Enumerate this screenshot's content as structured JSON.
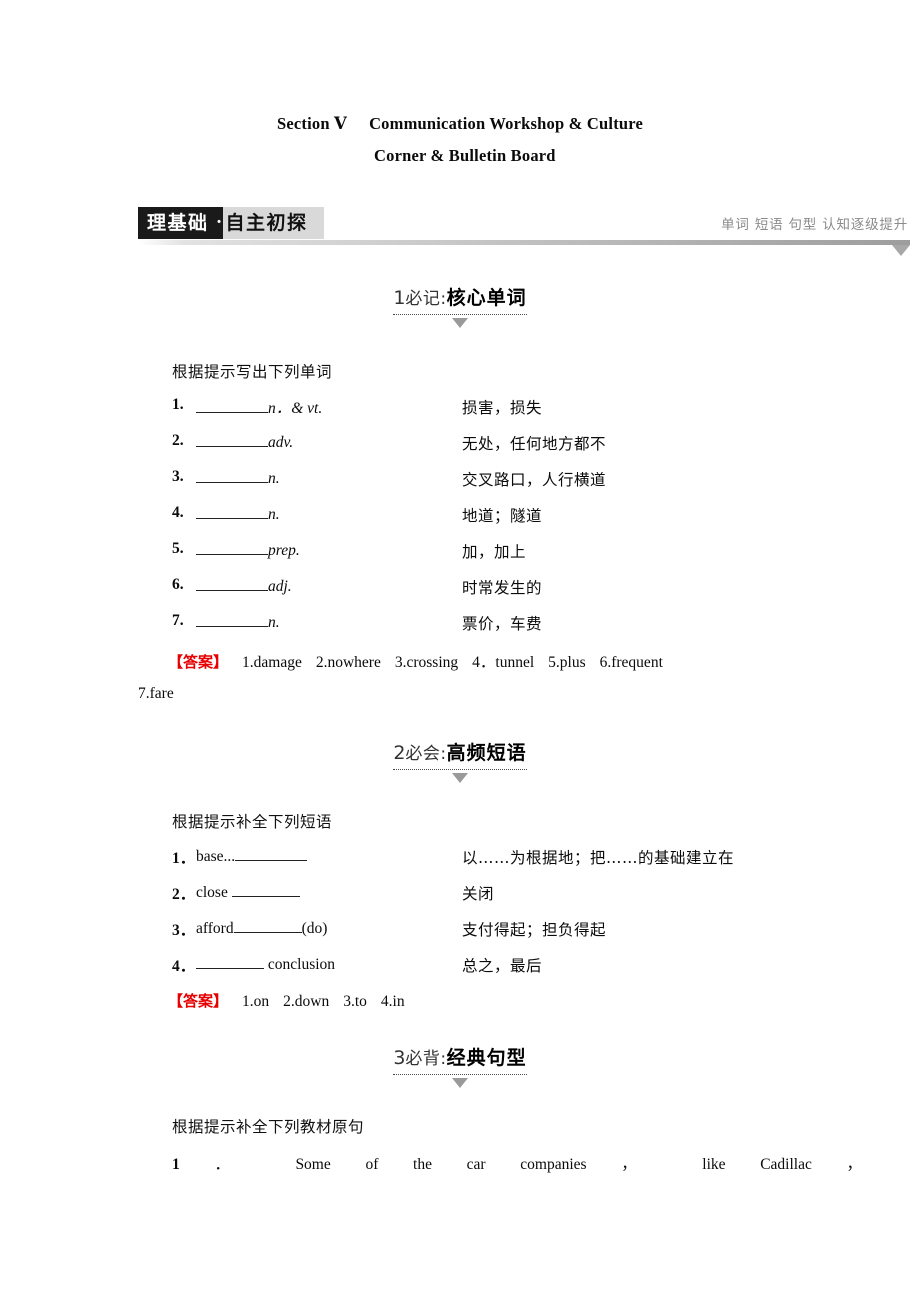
{
  "title": {
    "section_label": "Section Ⅴ",
    "line1": "Communication Workshop & Culture",
    "line2": "Corner & Bulletin Board"
  },
  "banner": {
    "tab_black": "理基础",
    "tab_dot": "·",
    "tab_gray": "自主初探",
    "subtitle": "单词 短语 句型 认知逐级提升",
    "accent_black": "#1a1a1a",
    "accent_gray": "#d9d9d9"
  },
  "sections": [
    {
      "num": "1",
      "pre": "必记:",
      "main": "核心单词",
      "lead": "根据提示写出下列单词",
      "items": [
        {
          "num": "1.",
          "blank": "",
          "pos": "n．& vt.",
          "def": "损害，损失"
        },
        {
          "num": "2.",
          "blank": "",
          "pos": "adv.",
          "def": "无处，任何地方都不"
        },
        {
          "num": "3.",
          "blank": "",
          "pos": "n.",
          "def": "交叉路口，人行横道"
        },
        {
          "num": "4.",
          "blank": "",
          "pos": "n.",
          "def": "地道；隧道"
        },
        {
          "num": "5.",
          "blank": "",
          "pos": "prep.",
          "def": "加，加上"
        },
        {
          "num": "6.",
          "blank": "",
          "pos": "adj.",
          "def": "时常发生的"
        },
        {
          "num": "7.",
          "blank": "",
          "pos": "n.",
          "def": "票价，车费"
        }
      ],
      "answer_label": "【答案】",
      "answers": [
        "1.damage",
        "2.nowhere",
        "3.crossing",
        "4．tunnel",
        "5.plus",
        "6.frequent"
      ],
      "answers_cont": "7.fare"
    },
    {
      "num": "2",
      "pre": "必会:",
      "main": "高频短语",
      "lead": "根据提示补全下列短语",
      "items": [
        {
          "num": "1．",
          "pre_text": "base...",
          "post_text": "",
          "def": "以……为根据地；把……的基础建立在"
        },
        {
          "num": "2．",
          "pre_text": "close ",
          "post_text": "",
          "def": "关闭"
        },
        {
          "num": "3．",
          "pre_text": "afford",
          "post_text": "(do)",
          "def": "支付得起；担负得起"
        },
        {
          "num": "4．",
          "pre_text": "",
          "post_text": " conclusion",
          "def": "总之，最后"
        }
      ],
      "answer_label": "【答案】",
      "answers": [
        "1.on",
        "2.down",
        "3.to",
        "4.in"
      ]
    },
    {
      "num": "3",
      "pre": "必背:",
      "main": "经典句型",
      "lead": "根据提示补全下列教材原句",
      "sentence_num": "1",
      "sentence_words": [
        "．",
        "Some",
        "of",
        "the",
        "car",
        "companies",
        "，",
        "like",
        "Cadillac",
        "，"
      ]
    }
  ]
}
